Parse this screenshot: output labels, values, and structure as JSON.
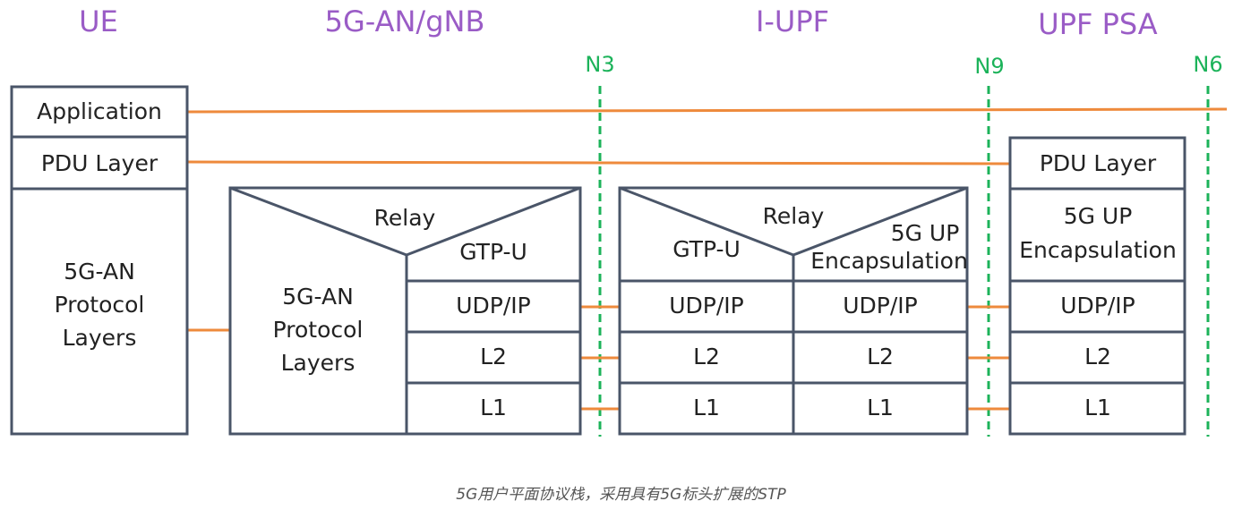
{
  "nodes": {
    "ue": "UE",
    "gnb": "5G-AN/gNB",
    "iupf": "I-UPF",
    "psa": "UPF PSA"
  },
  "interfaces": {
    "n3": "N3",
    "n9": "N9",
    "n6": "N6"
  },
  "ue_stack": {
    "application": "Application",
    "pdu_layer": "PDU Layer",
    "an_line1": "5G-AN",
    "an_line2": "Protocol",
    "an_line3": "Layers"
  },
  "gnb_stack": {
    "relay": "Relay",
    "an_line1": "5G-AN",
    "an_line2": "Protocol",
    "an_line3": "Layers",
    "gtpu": "GTP-U",
    "udpip": "UDP/IP",
    "l2": "L2",
    "l1": "L1"
  },
  "iupf_stack": {
    "relay": "Relay",
    "gtpu": "GTP-U",
    "encap_line1": "5G UP",
    "encap_line2": "Encapsulation",
    "udpip_left": "UDP/IP",
    "udpip_right": "UDP/IP",
    "l2_left": "L2",
    "l2_right": "L2",
    "l1_left": "L1",
    "l1_right": "L1"
  },
  "psa_stack": {
    "pdu_layer": "PDU Layer",
    "encap_line1": "5G UP",
    "encap_line2": "Encapsulation",
    "udpip": "UDP/IP",
    "l2": "L2",
    "l1": "L1"
  },
  "colors": {
    "node_title": "#9a5cc6",
    "interface": "#1cb35a",
    "peer_line": "#ee8a3c",
    "box_stroke": "#4a5568"
  },
  "caption": "5G用户平面协议栈，采用具有5G标头扩展的STP"
}
